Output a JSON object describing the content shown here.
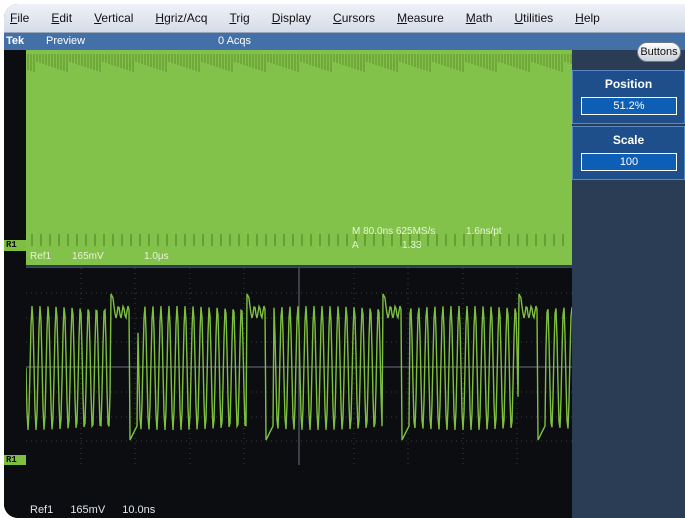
{
  "menu": [
    {
      "label": "File",
      "name": "menu-file"
    },
    {
      "label": "Edit",
      "name": "menu-edit"
    },
    {
      "label": "Vertical",
      "name": "menu-vertical"
    },
    {
      "label": "Hgriz/Acq",
      "name": "menu-horiz-acq"
    },
    {
      "label": "Trig",
      "name": "menu-trig"
    },
    {
      "label": "Display",
      "name": "menu-display"
    },
    {
      "label": "Cursors",
      "name": "menu-cursors"
    },
    {
      "label": "Measure",
      "name": "menu-measure"
    },
    {
      "label": "Math",
      "name": "menu-math"
    },
    {
      "label": "Utilities",
      "name": "menu-utilities"
    },
    {
      "label": "Help",
      "name": "menu-help"
    }
  ],
  "status": {
    "brand": "Tek",
    "mode": "Preview",
    "acqs": "0 Acqs",
    "buttons_label": "Buttons"
  },
  "overview": {
    "ref_label": "Ref1",
    "ref_scale": "165mV",
    "ref_time": "1.0μs",
    "horiz_readout": "M 80.0ns 625MS/s",
    "resolution": "1.6ns/pt",
    "trigger_readout": "A",
    "trigger_level": "1.33"
  },
  "zoom": {
    "ref_label": "Ref1",
    "ref_scale": "165mV",
    "ref_time": "10.0ns"
  },
  "controls": {
    "position_label": "Position",
    "position_value": "51.2%",
    "scale_label": "Scale",
    "scale_value": "100"
  },
  "markers": {
    "upper": "R1",
    "lower": "R1"
  },
  "colors": {
    "trace": "#7fbf3f",
    "overview_bg": "#82c24a",
    "screen_bg": "#0b0d10",
    "panel_blue": "#1f4f8a",
    "status_blue": "#4470a8"
  }
}
